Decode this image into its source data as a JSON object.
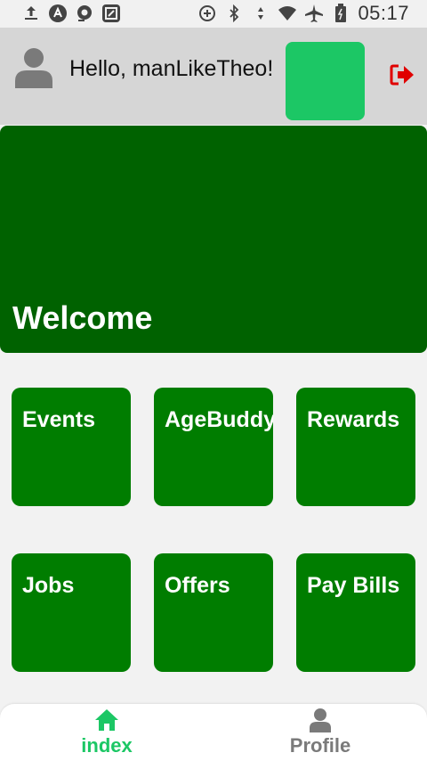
{
  "status_bar": {
    "time": "05:17",
    "left_icons": [
      "upload-icon",
      "app-a-icon",
      "camera-icon",
      "screenshot-icon"
    ],
    "right_icons": [
      "data-saver-icon",
      "bluetooth-icon",
      "wifi-icon",
      "airplane-icon",
      "battery-icon"
    ]
  },
  "header": {
    "greeting": "Hello, manLikeTheo!",
    "accent_color": "#1cc765",
    "logout_color": "#e00000"
  },
  "banner": {
    "title": "Welcome",
    "color": "#006200"
  },
  "tiles": [
    {
      "label": "Events"
    },
    {
      "label": "AgeBuddy C"
    },
    {
      "label": "Rewards"
    },
    {
      "label": "Jobs"
    },
    {
      "label": "Offers"
    },
    {
      "label": "Pay Bills"
    }
  ],
  "tile_color": "#007d00",
  "bottom_nav": {
    "items": [
      {
        "label": "index",
        "icon": "home-icon",
        "active": true,
        "color": "#1cc765"
      },
      {
        "label": "Profile",
        "icon": "person-icon",
        "active": false,
        "color": "#7a7a7a"
      }
    ]
  }
}
